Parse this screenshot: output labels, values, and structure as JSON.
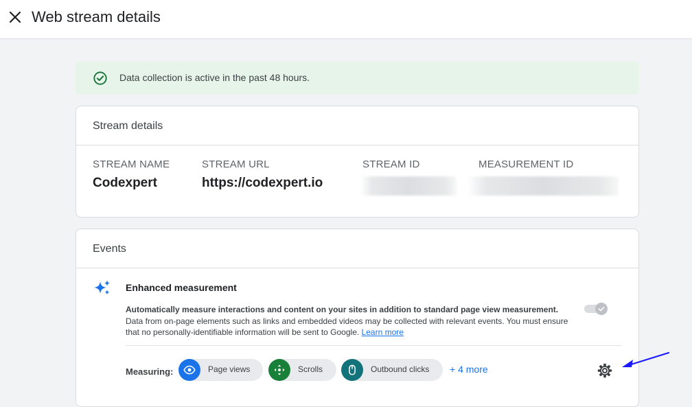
{
  "header": {
    "title": "Web stream details",
    "close_icon": "close-icon"
  },
  "banner": {
    "text": "Data collection is active in the past 48 hours.",
    "icon": "check-circle-icon",
    "color": "#137333"
  },
  "stream_details": {
    "heading": "Stream details",
    "columns": [
      {
        "label": "STREAM NAME",
        "value": "Codexpert"
      },
      {
        "label": "STREAM URL",
        "value": "https://codexpert.io"
      },
      {
        "label": "STREAM ID",
        "value": ""
      },
      {
        "label": "MEASUREMENT ID",
        "value": ""
      }
    ]
  },
  "events": {
    "heading": "Events",
    "enhanced": {
      "title": "Enhanced measurement",
      "description_bold": "Automatically measure interactions and content on your sites in addition to standard page view measurement.",
      "description": "Data from on-page elements such as links and embedded videos may be collected with relevant events. You must ensure that no personally-identifiable information will be sent to Google.",
      "learn_more": "Learn more",
      "toggle_on": true
    },
    "measuring_label": "Measuring:",
    "chips": [
      {
        "label": "Page views",
        "icon": "eye-icon",
        "color": "#1a73e8"
      },
      {
        "label": "Scrolls",
        "icon": "move-arrows-icon",
        "color": "#188038"
      },
      {
        "label": "Outbound clicks",
        "icon": "mouse-icon",
        "color": "#12737a"
      }
    ],
    "more_label": "+ 4 more",
    "settings_icon": "gear-icon"
  },
  "colors": {
    "accent": "#1a73e8",
    "annotation_arrow": "#1a1aff"
  }
}
